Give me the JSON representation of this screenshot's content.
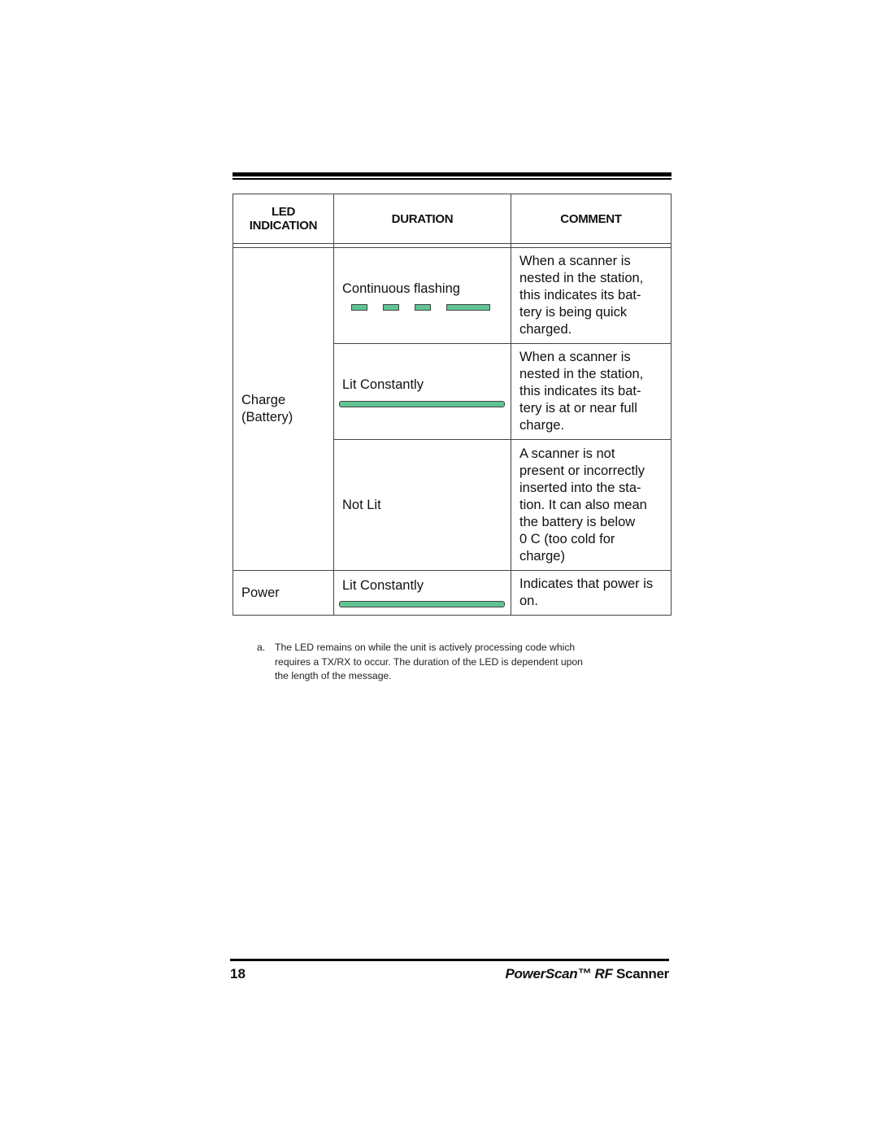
{
  "table": {
    "headers": {
      "indication_line1": "LED",
      "indication_line2": "INDICATION",
      "duration": "DURATION",
      "comment": "COMMENT"
    },
    "groups": [
      {
        "indication_line1": "Charge",
        "indication_line2": "(Battery)",
        "rows": [
          {
            "duration": "Continuous flashing",
            "led_pattern": "flashing",
            "comment_lines": [
              "When a scanner is",
              "nested in the station,",
              "this indicates its bat-",
              "tery is being quick",
              "charged."
            ]
          },
          {
            "duration": "Lit Constantly",
            "led_pattern": "solid",
            "comment_lines": [
              "When a scanner is",
              "nested in the station,",
              "this indicates its bat-",
              "tery is at or near full",
              "charge."
            ]
          },
          {
            "duration": "Not Lit",
            "led_pattern": "off",
            "comment_lines": [
              "A scanner is not",
              "present or incorrectly",
              "inserted into the sta-",
              "tion. It can also mean",
              "the battery is below",
              "0 C (too cold for",
              "charge)"
            ]
          }
        ]
      },
      {
        "indication_line1": "Power",
        "rows": [
          {
            "duration": "Lit Constantly",
            "led_pattern": "solid",
            "comment_lines": [
              "Indicates that power is",
              "on."
            ]
          }
        ]
      }
    ],
    "led_color": "#5fc493"
  },
  "footnote": {
    "label": "a.",
    "lines": [
      "The LED remains on while the unit is actively processing code which",
      "requires a TX/RX to occur. The duration of the LED is dependent upon",
      "the length of the message."
    ]
  },
  "footer": {
    "page_number": "18",
    "title_italic": "PowerScan™ RF",
    "title_regular": " Scanner"
  }
}
